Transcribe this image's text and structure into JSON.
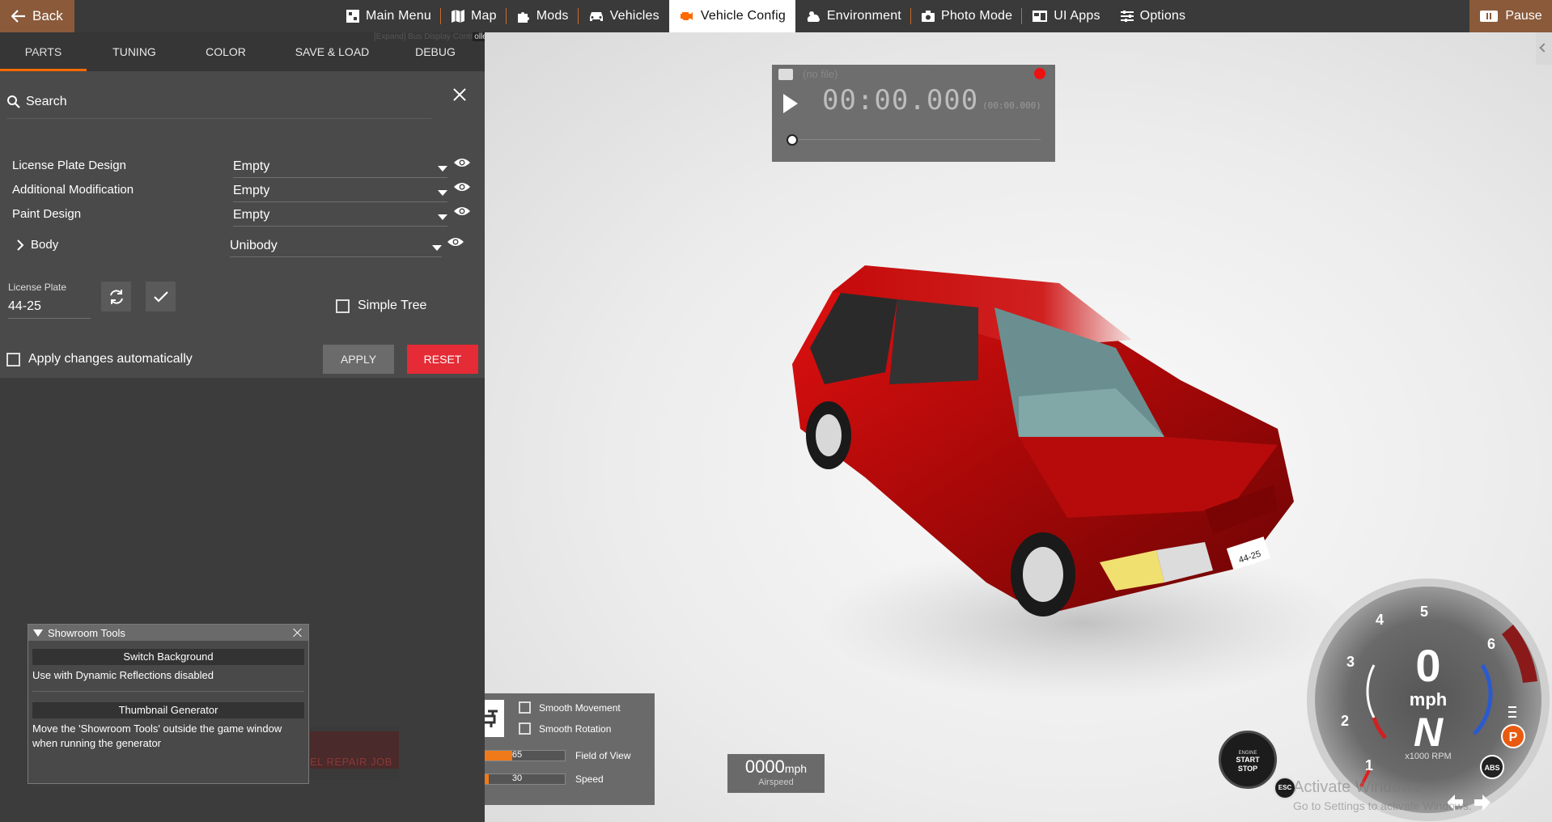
{
  "topbar": {
    "back_label": "Back",
    "pause_label": "Pause",
    "nav": [
      {
        "label": "Main Menu",
        "icon": "grid-icon"
      },
      {
        "label": "Map",
        "icon": "map-icon"
      },
      {
        "label": "Mods",
        "icon": "puzzle-icon"
      },
      {
        "label": "Vehicles",
        "icon": "car-icon"
      },
      {
        "label": "Vehicle Config",
        "icon": "engine-icon",
        "active": true
      },
      {
        "label": "Environment",
        "icon": "weather-icon"
      },
      {
        "label": "Photo Mode",
        "icon": "camera-icon"
      },
      {
        "label": "UI Apps",
        "icon": "apps-icon"
      },
      {
        "label": "Options",
        "icon": "sliders-icon"
      }
    ],
    "accent_color": "#ff6a00",
    "back_color": "#8a5a3a"
  },
  "panel": {
    "tabs": [
      "PARTS",
      "TUNING",
      "COLOR",
      "SAVE & LOAD",
      "DEBUG"
    ],
    "active_tab": "PARTS",
    "tooltip_dim": "[Expand] Bus Display Contr",
    "tooltip_bright": "oller",
    "search_label": "Search",
    "parts": [
      {
        "label": "License Plate Design",
        "value": "Empty"
      },
      {
        "label": "Additional Modification",
        "value": "Empty"
      },
      {
        "label": "Paint Design",
        "value": "Empty"
      },
      {
        "label": "Body",
        "value": "Unibody"
      }
    ],
    "license_plate_label": "License Plate",
    "license_plate_value": "44-25",
    "simple_tree_label": "Simple Tree",
    "apply_auto_label": "Apply changes automatically",
    "apply_label": "APPLY",
    "reset_label": "RESET",
    "reset_color": "#e42b36"
  },
  "replay": {
    "file": "(no file)",
    "time": "00:00.000",
    "time_small": "(00:00.000)"
  },
  "camera": {
    "smooth_movement": "Smooth Movement",
    "smooth_rotation": "Smooth Rotation",
    "fov_value": "65",
    "fov_label": "Field of View",
    "fov_fraction": 0.45,
    "speed_value": "30",
    "speed_label": "Speed",
    "speed_fraction": 0.2
  },
  "airspeed": {
    "value": "0000",
    "unit": "mph",
    "label": "Airspeed"
  },
  "showroom": {
    "title": "Showroom Tools",
    "switch_bg": "Switch Background",
    "switch_bg_hint": "Use with Dynamic Reflections disabled",
    "thumb_gen": "Thumbnail Generator",
    "thumb_gen_hint": "Move the 'Showroom Tools' outside the game window when running the generator",
    "repair_peek": "EL REPAIR JOB"
  },
  "gauge": {
    "speed": "0",
    "unit": "mph",
    "gear": "N",
    "rpm_label": "x1000 RPM",
    "ticks": [
      "1",
      "2",
      "3",
      "4",
      "5",
      "6"
    ],
    "park_label": "P",
    "abs_label": "ABS"
  },
  "engine": {
    "line1": "ENGINE",
    "line2": "START",
    "line3": "STOP"
  },
  "esc_label": "ESC",
  "watermark": {
    "title": "Activate Windows",
    "subtitle": "Go to Settings to activate Windows."
  }
}
